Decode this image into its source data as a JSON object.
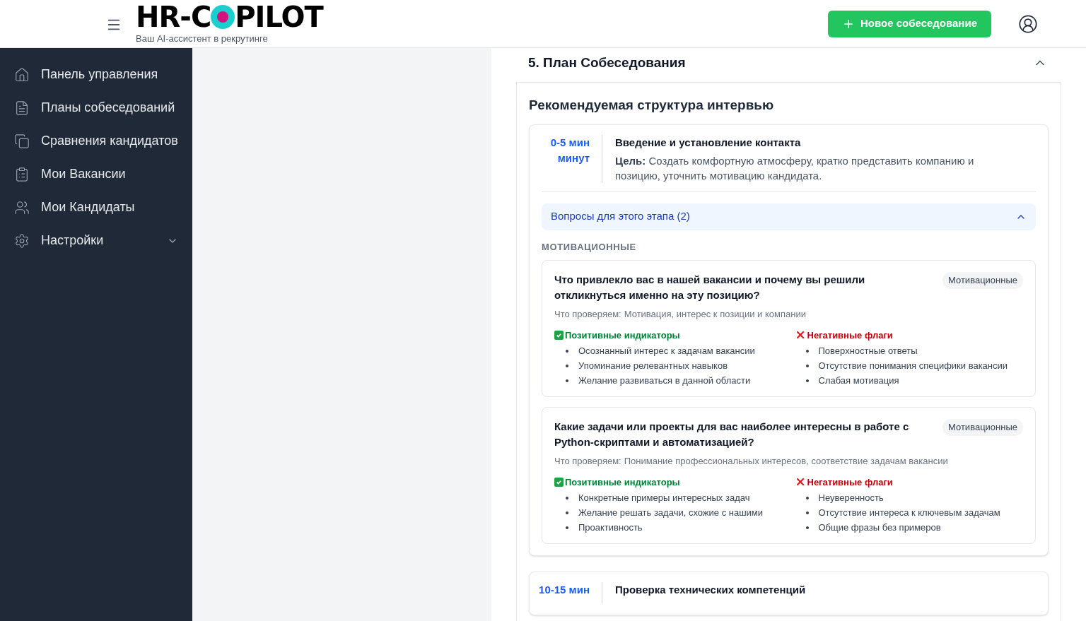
{
  "header": {
    "logo_before": "HR-C",
    "logo_after": "PILOT",
    "tagline": "Ваш AI-ассистент в рекрутинге",
    "new_button": "Новое собеседование"
  },
  "sidebar": {
    "items": [
      {
        "label": "Панель управления",
        "expandable": false
      },
      {
        "label": "Планы собеседований",
        "expandable": false
      },
      {
        "label": "Сравнения кандидатов",
        "expandable": false
      },
      {
        "label": "Мои Вакансии",
        "expandable": false
      },
      {
        "label": "Мои Кандидаты",
        "expandable": false
      },
      {
        "label": "Настройки",
        "expandable": true
      }
    ]
  },
  "section": {
    "title": "5. План Собеседования",
    "expanded": true,
    "subtitle": "Рекомендуемая структура интервью",
    "stages": [
      {
        "time": "0-5 мин",
        "unit": "минут",
        "title": "Введение и установление контакта",
        "goal_label": "Цель:",
        "goal": "Создать комфортную атмосферу, кратко представить компанию и позицию, уточнить мотивацию кандидата.",
        "questions_toggle": {
          "label": "Вопросы для этого этапа (2)",
          "expanded": true
        },
        "category": "МОТИВАЦИОННЫЕ",
        "questions": [
          {
            "text": "Что привлекло вас в нашей вакансии и почему вы решили откликнуться именно на эту позицию?",
            "tag": "Мотивационные",
            "checks_label": "Что проверяем:",
            "checks": "Мотивация, интерес к позиции и компании",
            "positive_title": "Позитивные индикаторы",
            "positive": [
              "Осознанный интерес к задачам вакансии",
              "Упоминание релевантных навыков",
              "Желание развиваться в данной области"
            ],
            "negative_title": "Негативные флаги",
            "negative": [
              "Поверхностные ответы",
              "Отсутствие понимания специфики вакансии",
              "Слабая мотивация"
            ]
          },
          {
            "text": "Какие задачи или проекты для вас наиболее интересны в работе с Python-скриптами и автоматизацией?",
            "tag": "Мотивационные",
            "checks_label": "Что проверяем:",
            "checks": "Понимание профессиональных интересов, соответствие задачам вакансии",
            "positive_title": "Позитивные индикаторы",
            "positive": [
              "Конкретные примеры интересных задач",
              "Желание решать задачи, схожие с нашими",
              "Проактивность"
            ],
            "negative_title": "Негативные флаги",
            "negative": [
              "Неуверенность",
              "Отсутствие интереса к ключевым задачам",
              "Общие фразы без примеров"
            ]
          }
        ]
      },
      {
        "time": "10-15 мин",
        "title": "Проверка технических компетенций"
      }
    ]
  }
}
